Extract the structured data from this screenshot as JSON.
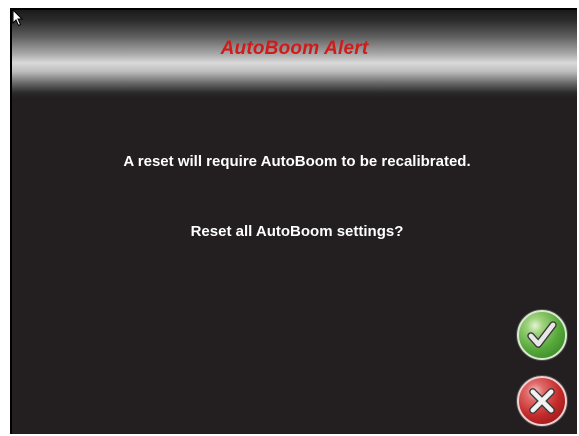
{
  "dialog": {
    "title": "AutoBoom Alert",
    "message": "A reset will require AutoBoom to be recalibrated.",
    "question": "Reset all AutoBoom settings?"
  },
  "buttons": {
    "confirm_icon": "checkmark-icon",
    "cancel_icon": "x-icon"
  },
  "colors": {
    "title": "#d11a1a",
    "background": "#231f20",
    "confirm": "#56a83a",
    "cancel": "#c42a2a"
  }
}
